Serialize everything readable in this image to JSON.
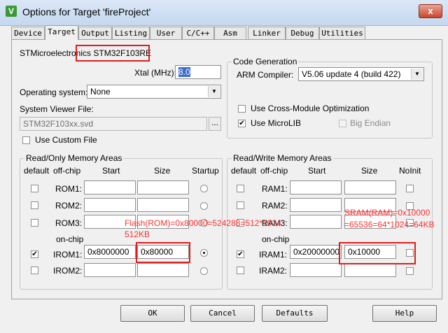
{
  "window": {
    "title": "Options for Target 'fireProject'",
    "icon": "keil-icon",
    "close_label": "x"
  },
  "tabs": [
    "Device",
    "Target",
    "Output",
    "Listing",
    "User",
    "C/C++",
    "Asm",
    "Linker",
    "Debug",
    "Utilities"
  ],
  "active_tab": "Target",
  "device": "STMicroelectronics STM32F103RE",
  "xtal": {
    "label": "Xtal (MHz):",
    "value": "8.0"
  },
  "os": {
    "label": "Operating system:",
    "value": "None"
  },
  "svd": {
    "label": "System Viewer File:",
    "value": "STM32F103xx.svd",
    "browse": "..."
  },
  "use_custom_file": "Use Custom File",
  "codegen": {
    "title": "Code Generation",
    "compiler_label": "ARM Compiler:",
    "compiler_value": "V5.06 update 4 (build 422)",
    "cross_module": "Use Cross-Module Optimization",
    "microlib": "Use MicroLIB",
    "big_endian": "Big Endian"
  },
  "rom": {
    "title": "Read/Only Memory Areas",
    "headers": {
      "default": "default",
      "offchip": "off-chip",
      "start": "Start",
      "size": "Size",
      "startup": "Startup"
    },
    "onchip": "on-chip",
    "rows": [
      {
        "name": "ROM1:",
        "start": "",
        "size": ""
      },
      {
        "name": "ROM2:",
        "start": "",
        "size": ""
      },
      {
        "name": "ROM3:",
        "start": "",
        "size": ""
      },
      {
        "name": "IROM1:",
        "start": "0x8000000",
        "size": "0x80000"
      },
      {
        "name": "IROM2:",
        "start": "",
        "size": ""
      }
    ]
  },
  "ram": {
    "title": "Read/Write Memory Areas",
    "headers": {
      "default": "default",
      "offchip": "off-chip",
      "start": "Start",
      "size": "Size",
      "noinit": "NoInit"
    },
    "onchip": "on-chip",
    "rows": [
      {
        "name": "RAM1:",
        "start": "",
        "size": ""
      },
      {
        "name": "RAM2:",
        "start": "",
        "size": ""
      },
      {
        "name": "RAM3:",
        "start": "",
        "size": ""
      },
      {
        "name": "IRAM1:",
        "start": "0x20000000",
        "size": "0x10000"
      },
      {
        "name": "IRAM2:",
        "start": "",
        "size": ""
      }
    ]
  },
  "annotations": {
    "flash_line1": "Flash(ROM)=0x80000=524288=512*1024",
    "flash_line2": "512KB",
    "sram_line1": "SRAM(RAM)=0x10000",
    "sram_line2": "=65536=64*1024=64KB"
  },
  "buttons": {
    "ok": "OK",
    "cancel": "Cancel",
    "defaults": "Defaults",
    "help": "Help"
  },
  "colors": {
    "annotation_red": "#e01e1e",
    "title_bar": "#c5d8ef",
    "selection": "#3a6ccf"
  }
}
